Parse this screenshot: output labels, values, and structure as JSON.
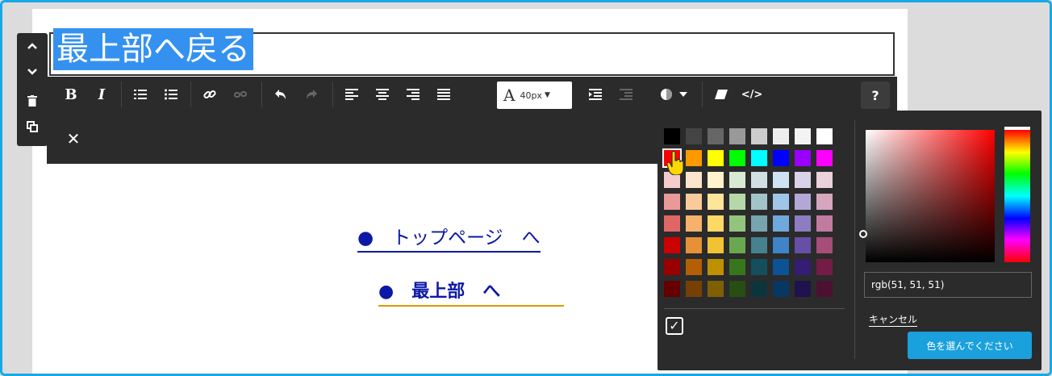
{
  "heading": {
    "text": "最上部へ戻る"
  },
  "side_tools": [
    "up",
    "down",
    "delete",
    "copy"
  ],
  "toolbar": {
    "bold": "B",
    "italic": "I",
    "font_size_value": "40px",
    "font_size_glyph": "A",
    "help": "?",
    "close": "✕"
  },
  "links": [
    {
      "text": "●　トップページ　へ"
    },
    {
      "text": "●　最上部　へ"
    }
  ],
  "color_picker": {
    "rgb_value": "rgb(51, 51, 51)",
    "cancel_label": "キャンセル",
    "choose_label": "色を選んでください",
    "selected_color": "#ff0000",
    "palette": [
      [
        "#000000",
        "#444444",
        "#666666",
        "#999999",
        "#cccccc",
        "#eeeeee",
        "#f3f3f3",
        "#ffffff"
      ],
      [
        "#ff0000",
        "#ff9900",
        "#ffff00",
        "#00ff00",
        "#00ffff",
        "#0000ff",
        "#9900ff",
        "#ff00ff"
      ],
      [
        "#f4cccc",
        "#fce5cd",
        "#fff2cc",
        "#d9ead3",
        "#d0e0e3",
        "#cfe2f3",
        "#d9d2e9",
        "#ead1dc"
      ],
      [
        "#ea9999",
        "#f9cb9c",
        "#ffe599",
        "#b6d7a8",
        "#a2c4c9",
        "#9fc5e8",
        "#b4a7d6",
        "#d5a6bd"
      ],
      [
        "#e06666",
        "#f6b26b",
        "#ffd966",
        "#93c47d",
        "#76a5af",
        "#6fa8dc",
        "#8e7cc3",
        "#c27ba0"
      ],
      [
        "#cc0000",
        "#e69138",
        "#f1c232",
        "#6aa84f",
        "#45818e",
        "#3d85c6",
        "#674ea7",
        "#a64d79"
      ],
      [
        "#990000",
        "#b45f06",
        "#bf9000",
        "#38761d",
        "#134f5c",
        "#0b5394",
        "#351c75",
        "#741b47"
      ],
      [
        "#660000",
        "#783f04",
        "#7f6000",
        "#274e13",
        "#0c343d",
        "#073763",
        "#20124d",
        "#4c1130"
      ]
    ]
  }
}
